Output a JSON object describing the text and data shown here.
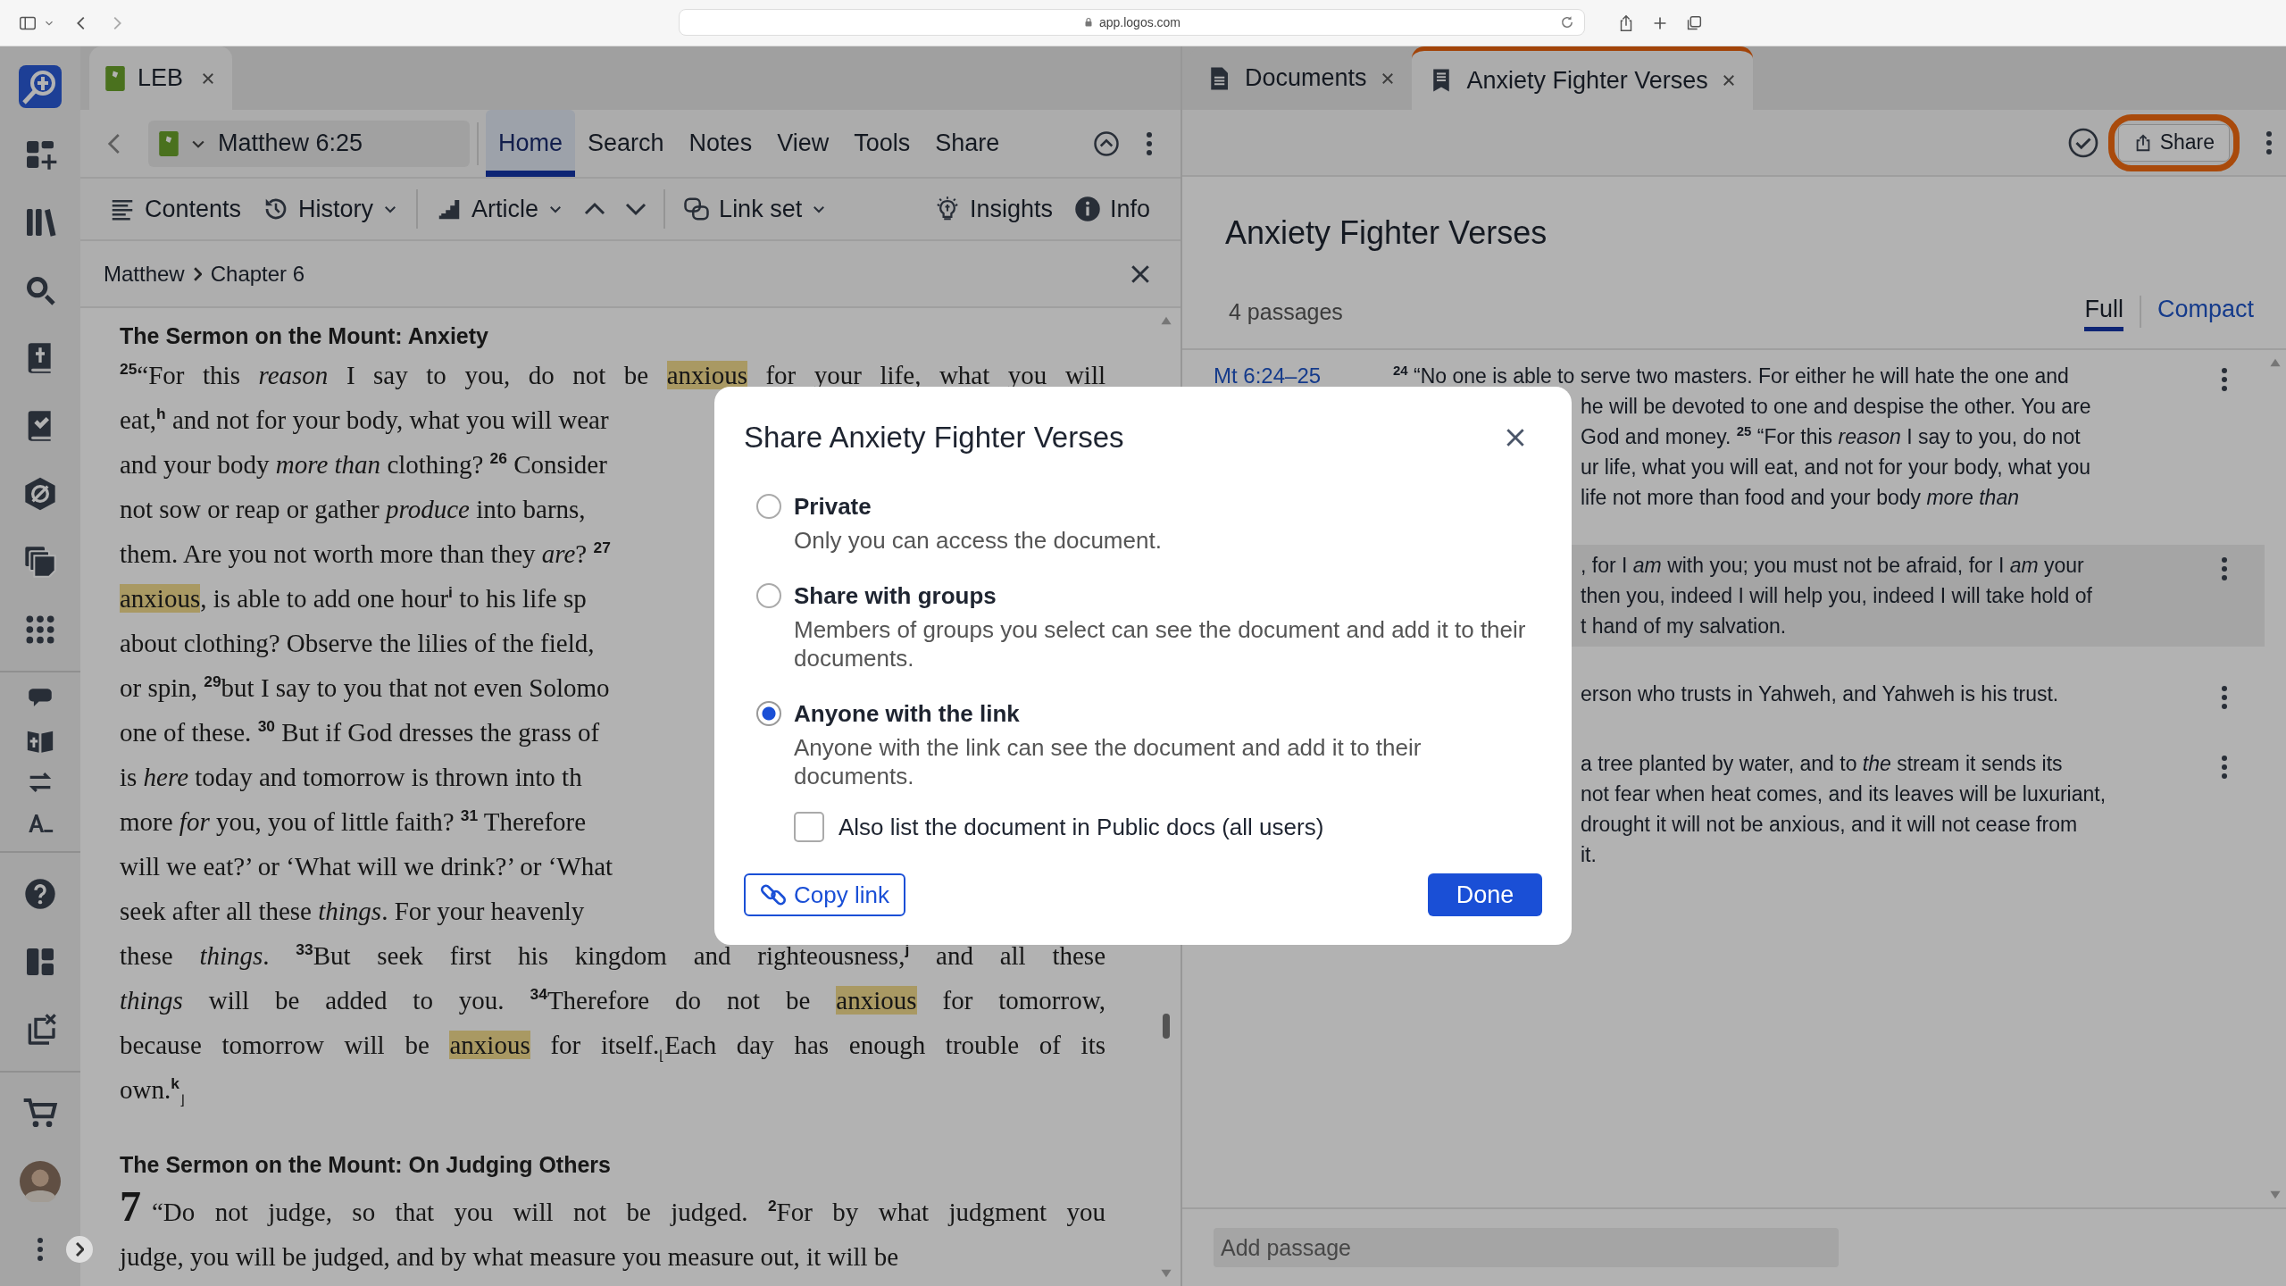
{
  "browser": {
    "url": "app.logos.com"
  },
  "left_pane": {
    "tab": {
      "label": "LEB"
    },
    "resource": {
      "reference": "Matthew 6:25"
    },
    "menu": [
      {
        "label": "Home",
        "selected": true
      },
      {
        "label": "Search",
        "selected": false
      },
      {
        "label": "Notes",
        "selected": false
      },
      {
        "label": "View",
        "selected": false
      },
      {
        "label": "Tools",
        "selected": false
      },
      {
        "label": "Share",
        "selected": false
      }
    ],
    "toolbar": [
      {
        "kind": "contents",
        "label": "Contents"
      },
      {
        "kind": "history",
        "label": "History"
      },
      {
        "kind": "article",
        "label": "Article"
      },
      {
        "kind": "linkset",
        "label": "Link set"
      },
      {
        "kind": "insights",
        "label": "Insights"
      },
      {
        "kind": "info",
        "label": "Info"
      }
    ],
    "breadcrumb": [
      "Matthew",
      "Chapter 6"
    ],
    "sections": [
      {
        "heading": "The Sermon on the Mount: Anxiety",
        "lines": [
          [
            {
              "text": "$^{25}$“For this *reason* I say to you, do not be ",
              "highlight": false
            },
            {
              "text": "anxious",
              "highlight": true
            },
            {
              "text": " for your life, what you will",
              "highlight": false
            }
          ],
          [
            {
              "text": "eat,$^{h}$ and not for your body, what you will wear",
              "highlight": false
            }
          ],
          [
            {
              "text": "and your body *more than* clothing? $^{26}$ Consider",
              "highlight": false
            }
          ],
          [
            {
              "text": "not sow or reap or gather *produce* into barns,",
              "highlight": false
            }
          ],
          [
            {
              "text": "them. Are you not worth more than they *are*? $^{27}$",
              "highlight": false
            }
          ],
          [
            {
              "text": "anxious",
              "highlight": true
            },
            {
              "text": ", is able to add one hour$^{i}$ to his life sp",
              "highlight": false
            }
          ],
          [
            {
              "text": "about clothing? Observe the lilies of the field,",
              "highlight": false
            }
          ],
          [
            {
              "text": "or spin, $^{29}$but I say to you that not even Solomo",
              "highlight": false
            }
          ],
          [
            {
              "text": "one of these. $^{30}$ But if God dresses the grass of",
              "highlight": false
            }
          ],
          [
            {
              "text": "is *here* today and tomorrow is thrown into th",
              "highlight": false
            }
          ],
          [
            {
              "text": "more *for* you, you of little faith? $^{31}$ Therefore",
              "highlight": false
            }
          ],
          [
            {
              "text": "will we eat?’ or ‘What will we drink?’ or ‘What",
              "highlight": false
            }
          ],
          [
            {
              "text": "seek after all these *things*. For your heavenly",
              "highlight": false
            }
          ],
          [
            {
              "text": "these *things*. $^{33}$But seek first his kingdom and righteousness,$^{j}$ and all these",
              "highlight": false
            }
          ],
          [
            {
              "text": "*things* will be added to you. $^{34}$Therefore do not be ",
              "highlight": false
            },
            {
              "text": "anxious",
              "highlight": true
            },
            {
              "text": " for tomorrow,",
              "highlight": false
            }
          ],
          [
            {
              "text": "because tomorrow will be ",
              "highlight": false
            },
            {
              "text": "anxious",
              "highlight": true
            },
            {
              "text": " for itself.$_{⌊}$Each day has enough trouble of its",
              "highlight": false
            }
          ],
          [
            {
              "text": "own.$^{k}$$_{⌋}$",
              "highlight": false
            }
          ]
        ]
      },
      {
        "heading": "The Sermon on the Mount: On Judging Others",
        "chapter": "7",
        "lines": [
          [
            {
              "text": "“Do not judge, so that you will not be judged. $^{2}$For by what judgment you",
              "highlight": false
            }
          ],
          [
            {
              "text": "judge, you will be judged, and by what measure you measure out, it will be",
              "highlight": false
            }
          ]
        ]
      }
    ]
  },
  "right_pane": {
    "tabs": [
      {
        "label": "Documents",
        "selected": false
      },
      {
        "label": "Anxiety Fighter Verses",
        "selected": true
      }
    ],
    "share_button": {
      "label": "Share",
      "highlighted": true
    },
    "title": "Anxiety Fighter Verses",
    "count": "4 passages",
    "views": [
      {
        "label": "Full",
        "selected": true
      },
      {
        "label": "Compact",
        "selected": false
      }
    ],
    "passages": [
      {
        "ref": "Mt 6:24–25",
        "selected": false,
        "lines": [
          "$^{24}$ “No one is able to serve two masters. For either he will hate the one and",
          "he will be devoted to one and despise the other. You are",
          "God and money. $^{25}$ “For this *reason* I say to you, do not",
          "ur life, what you will eat, and not for your body, what you",
          "life not more than food and your body *more than*"
        ]
      },
      {
        "selected": true,
        "lines": [
          ", for I *am* with you; you must not be afraid, for I *am* your",
          "then you, indeed I will help you, indeed I will take hold of",
          "t hand of my salvation."
        ]
      },
      {
        "selected": false,
        "lines": [
          "erson who trusts in Yahweh, and Yahweh is his trust."
        ]
      },
      {
        "selected": false,
        "lines": [
          "a tree planted by water, and to *the* stream it sends its",
          "not fear when heat comes, and its leaves will be luxuriant,",
          "drought it will not be anxious, and it will not cease from",
          "it."
        ]
      }
    ],
    "add_passage": {
      "placeholder": "Add passage"
    }
  },
  "dialog": {
    "title": "Share Anxiety Fighter Verses",
    "options": [
      {
        "label": "Private",
        "description": "Only you can access the document.",
        "selected": false
      },
      {
        "label": "Share with groups",
        "description": "Members of groups you select can see the document and add it to their documents.",
        "selected": false
      },
      {
        "label": "Anyone with the link",
        "description": "Anyone with the link can see the document and add it to their documents.",
        "selected": true
      }
    ],
    "checkbox": {
      "label": "Also list the document in Public docs (all users)",
      "checked": false
    },
    "copy_button": "Copy link",
    "done_button": "Done"
  }
}
